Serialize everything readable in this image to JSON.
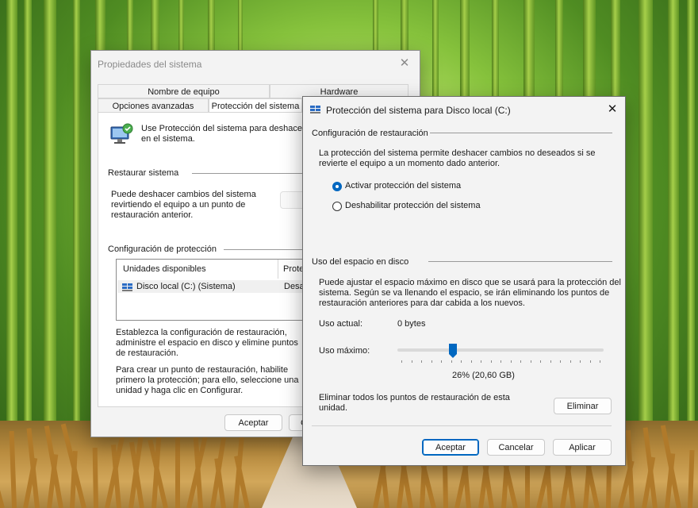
{
  "sys_props": {
    "title": "Propiedades del sistema",
    "tabs_top": [
      "Nombre de equipo",
      "Hardware"
    ],
    "tabs_bottom": [
      "Opciones avanzadas",
      "Protección del sistema"
    ],
    "intro": "Use Protección del sistema para deshacer c",
    "intro2": "en el sistema.",
    "restore_group": "Restaurar sistema",
    "restore_desc": [
      "Puede deshacer cambios del sistema",
      "revirtiendo el equipo a un punto de",
      "restauración anterior."
    ],
    "protection_group": "Configuración de protección",
    "list_headers": [
      "Unidades disponibles",
      "Prote"
    ],
    "list_rows": [
      {
        "drive": "Disco local (C:) (Sistema)",
        "status": "Desac"
      }
    ],
    "configure_desc": [
      "Establezca la configuración de restauración,",
      "administre el espacio en disco y elimine puntos",
      "de restauración."
    ],
    "create_desc": [
      "Para crear un punto de restauración, habilite",
      "primero la protección; para ello, seleccione una",
      "unidad y haga clic en Configurar."
    ],
    "ok_label": "Aceptar",
    "cancel_partial": "C"
  },
  "protect_dialog": {
    "title": "Protección del sistema para Disco local (C:)",
    "restore_settings_group": "Configuración de restauración",
    "restore_settings_desc": [
      "La protección del sistema permite deshacer cambios no deseados si se",
      "revierte el equipo a un momento dado anterior."
    ],
    "option_on": "Activar protección del sistema",
    "option_off": "Deshabilitar protección del sistema",
    "disk_group": "Uso del espacio en disco",
    "disk_desc": [
      "Puede ajustar el espacio máximo en disco que se usará para la protección del",
      "sistema. Según se va llenando el espacio, se irán eliminando los puntos de",
      "restauración anteriores para dar cabida a los nuevos."
    ],
    "current_usage_label": "Uso actual:",
    "current_usage_value": "0 bytes",
    "max_usage_label": "Uso máximo:",
    "max_usage_fraction": 0.26,
    "max_usage_readout": "26% (20,60 GB)",
    "delete_desc": [
      "Eliminar todos los puntos de restauración de esta",
      "unidad."
    ],
    "delete_button": "Eliminar",
    "ok_button": "Aceptar",
    "cancel_button": "Cancelar",
    "apply_button": "Aplicar",
    "accent_color": "#0067c0"
  }
}
